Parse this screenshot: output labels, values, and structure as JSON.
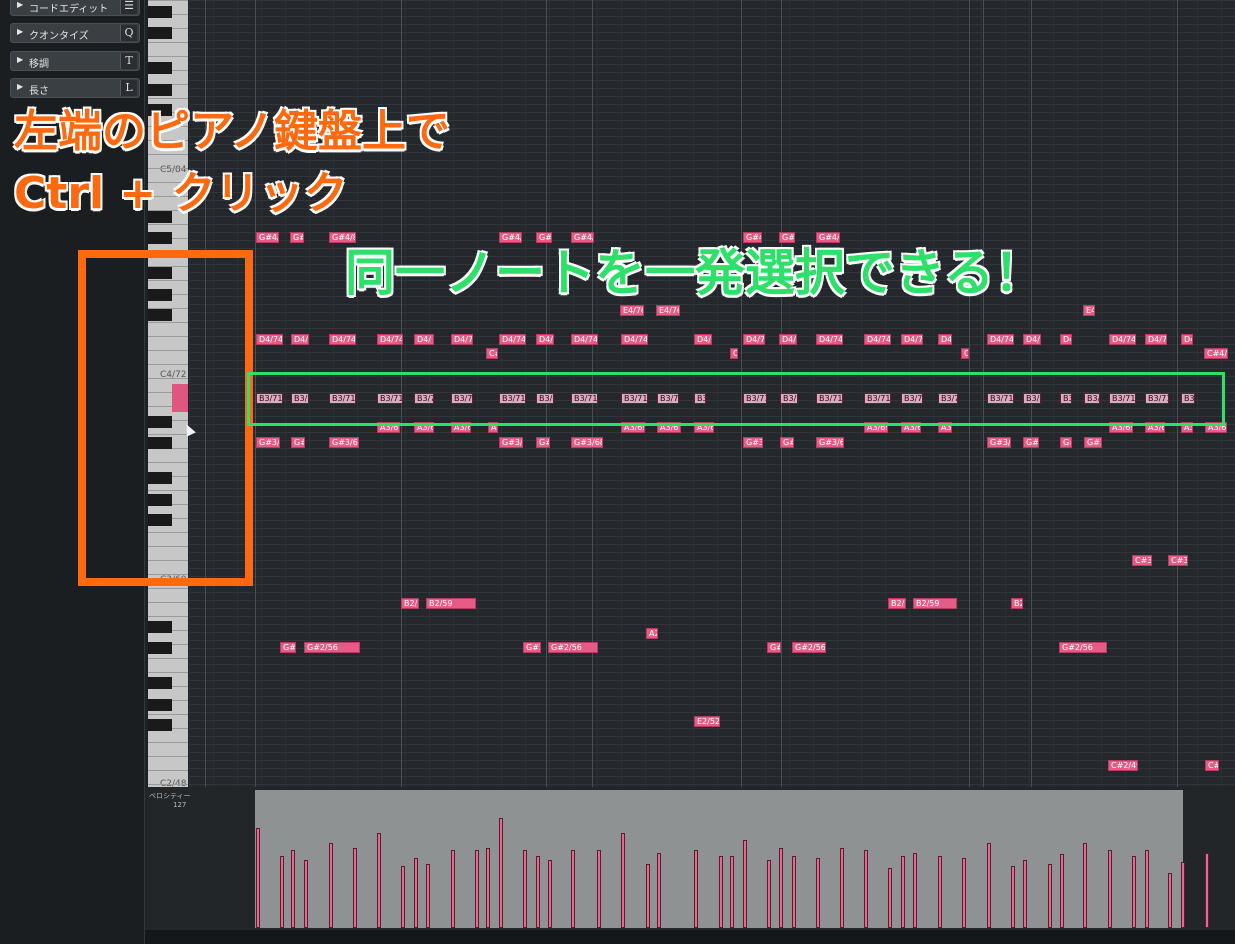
{
  "sections": [
    {
      "label": "コードエディット",
      "shortcut": "☰"
    },
    {
      "label": "クオンタイズ",
      "shortcut": "Q"
    },
    {
      "label": "移調",
      "shortcut": "T"
    },
    {
      "label": "長さ",
      "shortcut": "L"
    }
  ],
  "keyboard": {
    "labels": [
      "C5/84",
      "C4/72",
      "C3/60",
      "C2/48"
    ]
  },
  "velocity": {
    "title": "ベロシティー",
    "max": "127"
  },
  "annotations": {
    "orange_line1": "左端のピアノ鍵盤上で",
    "orange_line2": "Ctrl + クリック",
    "green": "同一ノートを一発選択できる！"
  },
  "notes": [
    {
      "label": "G#4/8",
      "row": "G#4"
    },
    {
      "label": "G#",
      "row": "G#4"
    },
    {
      "label": "G#4/8",
      "row": "G#4"
    },
    {
      "label": "G#4/",
      "row": "G#4"
    },
    {
      "label": "G#",
      "row": "G#4"
    },
    {
      "label": "G#4/",
      "row": "G#4"
    },
    {
      "label": "G#4,",
      "row": "G#4"
    },
    {
      "label": "G#4",
      "row": "G#4"
    },
    {
      "label": "G#4/8",
      "row": "G#4"
    },
    {
      "label": "E4/76",
      "row": "E4"
    },
    {
      "label": "E4/76",
      "row": "E4"
    },
    {
      "label": "E4",
      "row": "E4"
    },
    {
      "label": "D4/74",
      "row": "D4"
    },
    {
      "label": "D4/",
      "row": "D4"
    },
    {
      "label": "D4/74",
      "row": "D4"
    },
    {
      "label": "D4/74",
      "row": "D4"
    },
    {
      "label": "D4/",
      "row": "D4"
    },
    {
      "label": "D4/7",
      "row": "D4"
    },
    {
      "label": "D4/74",
      "row": "D4"
    },
    {
      "label": "D4/",
      "row": "D4"
    },
    {
      "label": "D4/74",
      "row": "D4"
    },
    {
      "label": "D4/74",
      "row": "D4"
    },
    {
      "label": "D4/",
      "row": "D4"
    },
    {
      "label": "D4/7",
      "row": "D4"
    },
    {
      "label": "D4/",
      "row": "D4"
    },
    {
      "label": "D4/74",
      "row": "D4"
    },
    {
      "label": "D4/74",
      "row": "D4"
    },
    {
      "label": "D4/7",
      "row": "D4"
    },
    {
      "label": "D4",
      "row": "D4"
    },
    {
      "label": "D4/74",
      "row": "D4"
    },
    {
      "label": "D4/",
      "row": "D4"
    },
    {
      "label": "D4",
      "row": "D4"
    },
    {
      "label": "D4/74",
      "row": "D4"
    },
    {
      "label": "D4/7",
      "row": "D4"
    },
    {
      "label": "D4",
      "row": "D4"
    },
    {
      "label": "C#",
      "row": "C#4"
    },
    {
      "label": "C",
      "row": "C#4"
    },
    {
      "label": "C",
      "row": "C#4"
    },
    {
      "label": "C#4/",
      "row": "C#4"
    },
    {
      "label": "B3/71",
      "row": "B3"
    },
    {
      "label": "B3/",
      "row": "B3"
    },
    {
      "label": "B3/71",
      "row": "B3"
    },
    {
      "label": "B3/71",
      "row": "B3"
    },
    {
      "label": "B3/7",
      "row": "B3"
    },
    {
      "label": "B3/71",
      "row": "B3"
    },
    {
      "label": "B3/71",
      "row": "B3"
    },
    {
      "label": "B3/",
      "row": "B3"
    },
    {
      "label": "B3/71",
      "row": "B3"
    },
    {
      "label": "B3/71",
      "row": "B3"
    },
    {
      "label": "B3/71",
      "row": "B3"
    },
    {
      "label": "B3",
      "row": "B3"
    },
    {
      "label": "B3/71",
      "row": "B3"
    },
    {
      "label": "B3/",
      "row": "B3"
    },
    {
      "label": "B3/71",
      "row": "B3"
    },
    {
      "label": "B3/71",
      "row": "B3"
    },
    {
      "label": "B3/71",
      "row": "B3"
    },
    {
      "label": "B3/7",
      "row": "B3"
    },
    {
      "label": "B3/71",
      "row": "B3"
    },
    {
      "label": "B3/7",
      "row": "B3"
    },
    {
      "label": "B3",
      "row": "B3"
    },
    {
      "label": "B3/",
      "row": "B3"
    },
    {
      "label": "B3/71",
      "row": "B3"
    },
    {
      "label": "B3/71",
      "row": "B3"
    },
    {
      "label": "B3/",
      "row": "B3"
    },
    {
      "label": "A3/69",
      "row": "A3"
    },
    {
      "label": "A3/6",
      "row": "A3"
    },
    {
      "label": "A3/6",
      "row": "A3"
    },
    {
      "label": "A3",
      "row": "A3"
    },
    {
      "label": "A3/69",
      "row": "A3"
    },
    {
      "label": "A3/6",
      "row": "A3"
    },
    {
      "label": "A3/6",
      "row": "A3"
    },
    {
      "label": "A3/69",
      "row": "A3"
    },
    {
      "label": "A3/6",
      "row": "A3"
    },
    {
      "label": "A3",
      "row": "A3"
    },
    {
      "label": "A3/69",
      "row": "A3"
    },
    {
      "label": "A3/6",
      "row": "A3"
    },
    {
      "label": "A3",
      "row": "A3"
    },
    {
      "label": "A3/6",
      "row": "A3"
    },
    {
      "label": "G#3/",
      "row": "G#3"
    },
    {
      "label": "G#",
      "row": "G#3"
    },
    {
      "label": "G#3/68",
      "row": "G#3"
    },
    {
      "label": "G#3/",
      "row": "G#3"
    },
    {
      "label": "G#",
      "row": "G#3"
    },
    {
      "label": "G#3/68",
      "row": "G#3"
    },
    {
      "label": "G#3/",
      "row": "G#3"
    },
    {
      "label": "G#",
      "row": "G#3"
    },
    {
      "label": "G#3/68",
      "row": "G#3"
    },
    {
      "label": "G#3/6",
      "row": "G#3"
    },
    {
      "label": "G#",
      "row": "G#3"
    },
    {
      "label": "G#",
      "row": "G#3"
    },
    {
      "label": "G#3,",
      "row": "G#3"
    },
    {
      "label": "C#3/",
      "row": "C#3"
    },
    {
      "label": "C#3/",
      "row": "C#3"
    },
    {
      "label": "B2/5",
      "row": "B2"
    },
    {
      "label": "B2/59",
      "row": "B2"
    },
    {
      "label": "B2/",
      "row": "B2"
    },
    {
      "label": "B2/59",
      "row": "B2"
    },
    {
      "label": "B2,",
      "row": "B2"
    },
    {
      "label": "A2",
      "row": "A2"
    },
    {
      "label": "G#",
      "row": "G#2"
    },
    {
      "label": "G#2/56",
      "row": "G#2"
    },
    {
      "label": "G#2",
      "row": "G#2"
    },
    {
      "label": "G#2/56",
      "row": "G#2"
    },
    {
      "label": "G#",
      "row": "G#2"
    },
    {
      "label": "G#2/56",
      "row": "G#2"
    },
    {
      "label": "G#2/56",
      "row": "G#2"
    },
    {
      "label": "E2/52",
      "row": "E2"
    },
    {
      "label": "C#2/49",
      "row": "C#2"
    },
    {
      "label": "C#",
      "row": "C#2"
    }
  ]
}
